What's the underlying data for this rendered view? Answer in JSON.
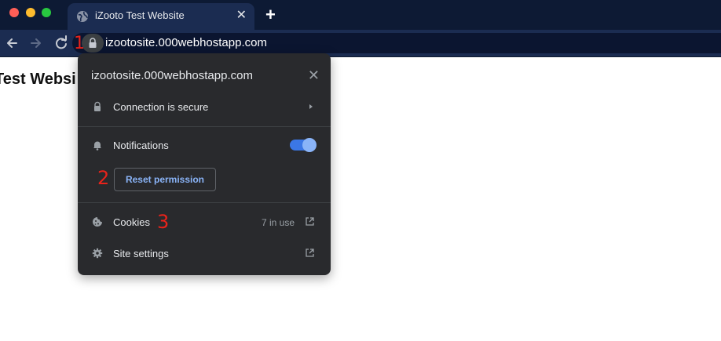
{
  "browser": {
    "tab_title": "iZooto Test Website",
    "url": "izootosite.000webhostapp.com"
  },
  "page": {
    "heading": "Test Websi"
  },
  "popup": {
    "title": "izootosite.000webhostapp.com",
    "connection_label": "Connection is secure",
    "notifications_label": "Notifications",
    "notifications_enabled": true,
    "reset_button_label": "Reset permission",
    "cookies_label": "Cookies",
    "cookies_count": "7 in use",
    "site_settings_label": "Site settings"
  },
  "annotations": {
    "marker_1": "1",
    "marker_2": "2",
    "marker_3": "3"
  },
  "colors": {
    "tabstrip": "#0d1a34",
    "toolbar": "#1b2c51",
    "popup_bg": "#292a2d",
    "accent": "#8ab4f8",
    "annotation": "#e8231b"
  },
  "icons": [
    "globe-icon",
    "close-icon",
    "plus-icon",
    "back-arrow-icon",
    "forward-arrow-icon",
    "reload-icon",
    "lock-icon",
    "bell-icon",
    "cookie-icon",
    "gear-icon",
    "caret-right-icon",
    "external-link-icon"
  ]
}
